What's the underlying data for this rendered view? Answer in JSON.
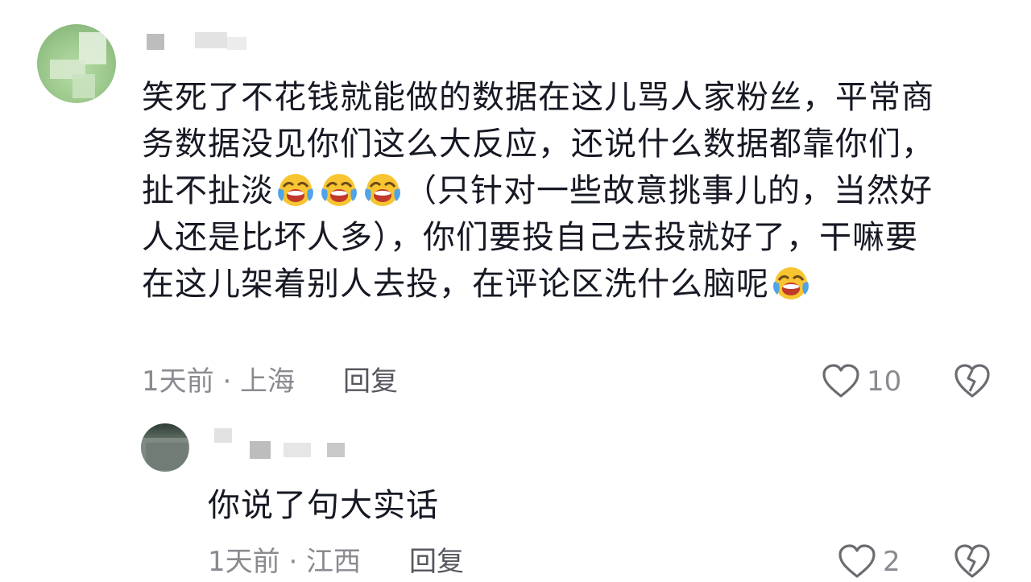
{
  "comment": {
    "text_lines": [
      "笑死了不花钱就能做的数据在这儿骂人家粉丝，平常商",
      "务数据没见你们这么大反应，还说什么数据都靠你们，",
      "扯不扯淡",
      "（只针对一些故意挑事儿的，当然好",
      "人还是比坏人多），你们要投自己去投就好了，干嘛要",
      "在这儿架着别人去投，在评论区洗什么脑呢"
    ],
    "meta": "1天前 · 上海",
    "reply_label": "回复",
    "like_count": "10",
    "emoji": "laugh-cry-emoji"
  },
  "reply": {
    "text": "你说了句大实话",
    "meta": "1天前 · 江西",
    "reply_label": "回复",
    "like_count": "2"
  },
  "colors": {
    "text": "#161823",
    "meta": "#8a8b91",
    "icon": "#6b6c72"
  }
}
